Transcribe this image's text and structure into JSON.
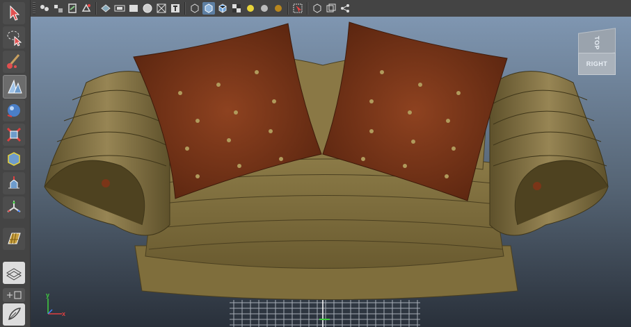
{
  "toolbar": {
    "icons": [
      "snap-grid-icon",
      "snap-curve-icon",
      "snap-point-icon",
      "snap-plane-icon",
      "snap-live-icon",
      "wireframe-icon",
      "film-gate-icon",
      "shaded-icon",
      "texture-icon",
      "checker-icon",
      "text-icon",
      "cube-wire-icon",
      "cube-solid-icon",
      "cube-textured-icon",
      "light-yellow-icon",
      "light-white-icon",
      "light-gold-icon",
      "select-region-icon",
      "isolate-icon",
      "frame-icon",
      "nodes-icon"
    ]
  },
  "toolbox": {
    "tools": [
      "select-arrow-tool",
      "lasso-tool",
      "paint-select-tool",
      "move-tool",
      "rotate-tool",
      "scale-tool",
      "universal-manipulator-tool",
      "soft-mod-tool",
      "show-manipulator-tool",
      "uv-editor-tool"
    ]
  },
  "viewcube": {
    "top_label": "TOP",
    "right_label": "RIGHT"
  },
  "axis": {
    "x_label": "x",
    "y_label": "y",
    "x_color": "#e04040",
    "y_color": "#40d040",
    "z_color": "#4080ff"
  },
  "colors": {
    "sofa_body": "#7a6a3c",
    "sofa_shadow": "#4a3f20",
    "sofa_highlight": "#a3915a",
    "pillow": "#7b3518",
    "pillow_highlight": "#a8562a",
    "pillow_button": "#b09a5c",
    "grid": "#cfd6de"
  }
}
